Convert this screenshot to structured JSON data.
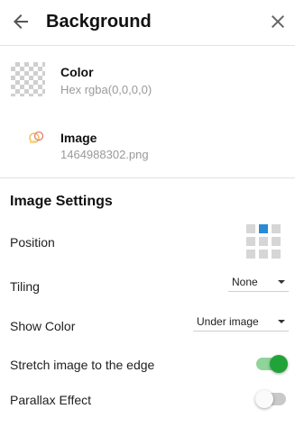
{
  "header": {
    "title": "Background",
    "back_icon": "arrow-left-icon",
    "close_icon": "close-icon"
  },
  "color_item": {
    "title": "Color",
    "subtitle": "Hex rgba(0,0,0,0)",
    "icon": "transparent-checkerboard-swatch"
  },
  "image_item": {
    "title": "Image",
    "subtitle": "1464988302.png",
    "icon": "image-thumbnail"
  },
  "image_settings": {
    "title": "Image Settings",
    "position": {
      "label": "Position",
      "icon": "position-grid-icon",
      "selected": "top-center"
    },
    "tiling": {
      "label": "Tiling",
      "value": "None"
    },
    "show_color": {
      "label": "Show Color",
      "value": "Under image"
    },
    "stretch": {
      "label": "Stretch image to the edge",
      "on": true
    },
    "parallax": {
      "label": "Parallax Effect",
      "on": false
    }
  },
  "colors": {
    "accent_blue": "#2a8ad4",
    "toggle_on": "#21a33a",
    "toggle_on_track": "#8fd49a",
    "toggle_off_track": "#c9c9c9"
  }
}
